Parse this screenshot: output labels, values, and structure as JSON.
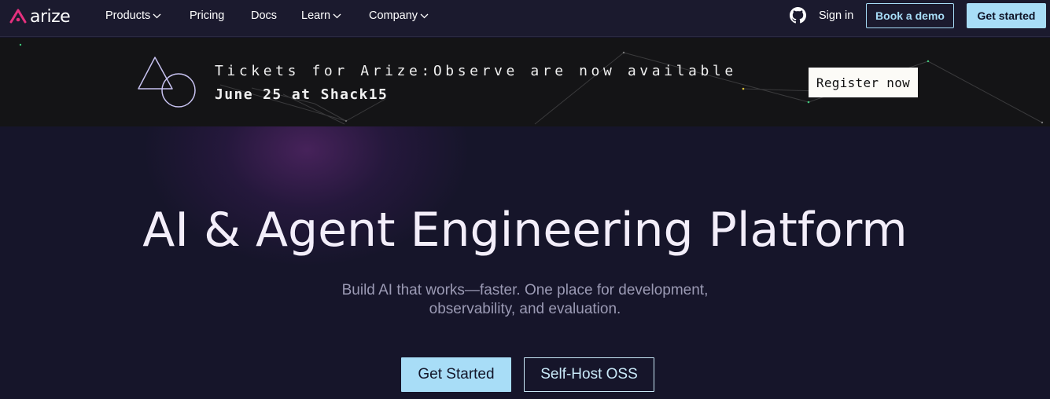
{
  "nav": {
    "logo_text": "arize",
    "items": [
      {
        "label": "Products",
        "dropdown": true
      },
      {
        "label": "Pricing",
        "dropdown": false
      },
      {
        "label": "Docs",
        "dropdown": false
      },
      {
        "label": "Learn",
        "dropdown": true
      },
      {
        "label": "Company",
        "dropdown": true
      }
    ],
    "github_icon": "github-icon",
    "sign_in": "Sign in",
    "book_demo": "Book a demo",
    "get_started": "Get started"
  },
  "banner": {
    "line1": "Tickets for Arize:Observe are now available",
    "line2": "June 25 at Shack15",
    "register_label": "Register now"
  },
  "hero": {
    "title": "AI & Agent Engineering Platform",
    "subtitle_line1": "Build AI that works—faster. One place for development,",
    "subtitle_line2": "observability, and evaluation.",
    "cta_primary": "Get Started",
    "cta_secondary": "Self-Host OSS"
  },
  "colors": {
    "accent_blue": "#a8ddf7",
    "brand_pink": "#e4307e",
    "background": "#16152a"
  }
}
